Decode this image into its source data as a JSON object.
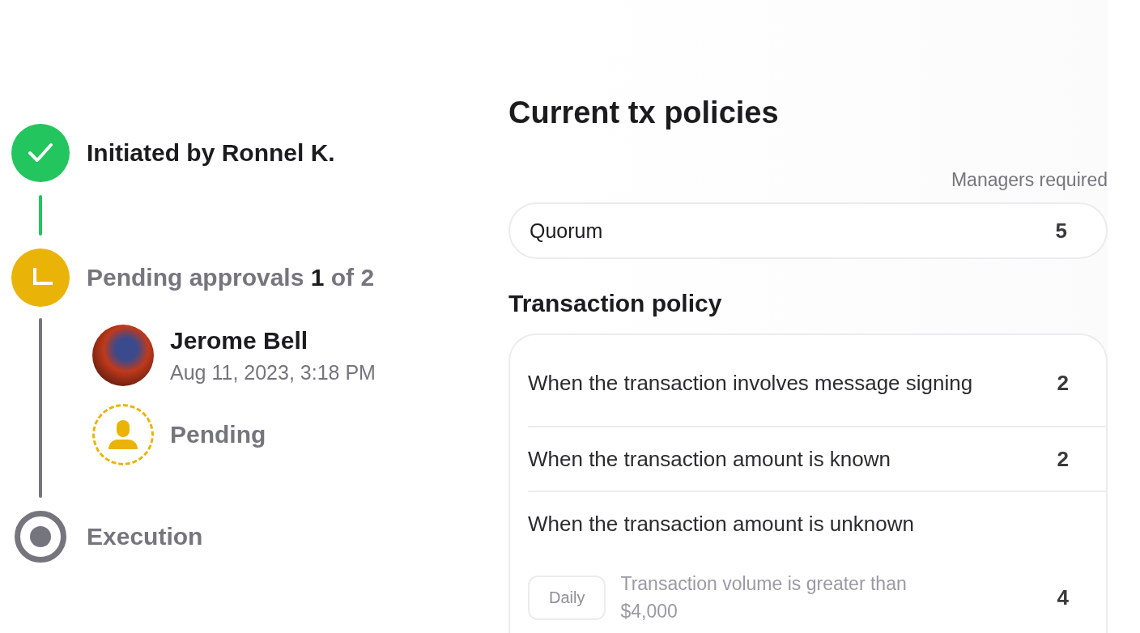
{
  "timeline": {
    "steps": [
      {
        "kind": "done",
        "label": "Initiated by Ronnel K."
      },
      {
        "kind": "pending",
        "label": "Pending approvals **1** of 2",
        "approvers": [
          {
            "kind": "signed",
            "name": "Jerome Bell",
            "time": "Aug 11, 2023, 3:18 PM"
          },
          {
            "kind": "waiting",
            "name": "Pending"
          }
        ]
      },
      {
        "kind": "upcoming",
        "label": "Execution"
      }
    ]
  },
  "policies": {
    "title": "Current tx policies",
    "column_header": "Managers required",
    "quorum": {
      "label": "Quorum",
      "value": "5"
    },
    "section_title": "Transaction policy",
    "rules": [
      {
        "text": "When the transaction involves message signing",
        "value": "2"
      },
      {
        "text": "When the transaction amount is known",
        "value": "2"
      },
      {
        "text": "When the transaction amount is unknown",
        "conditions": [
          {
            "period": "Daily",
            "text": "Transaction volume is greater than $4,000",
            "value": "4"
          }
        ]
      }
    ]
  }
}
